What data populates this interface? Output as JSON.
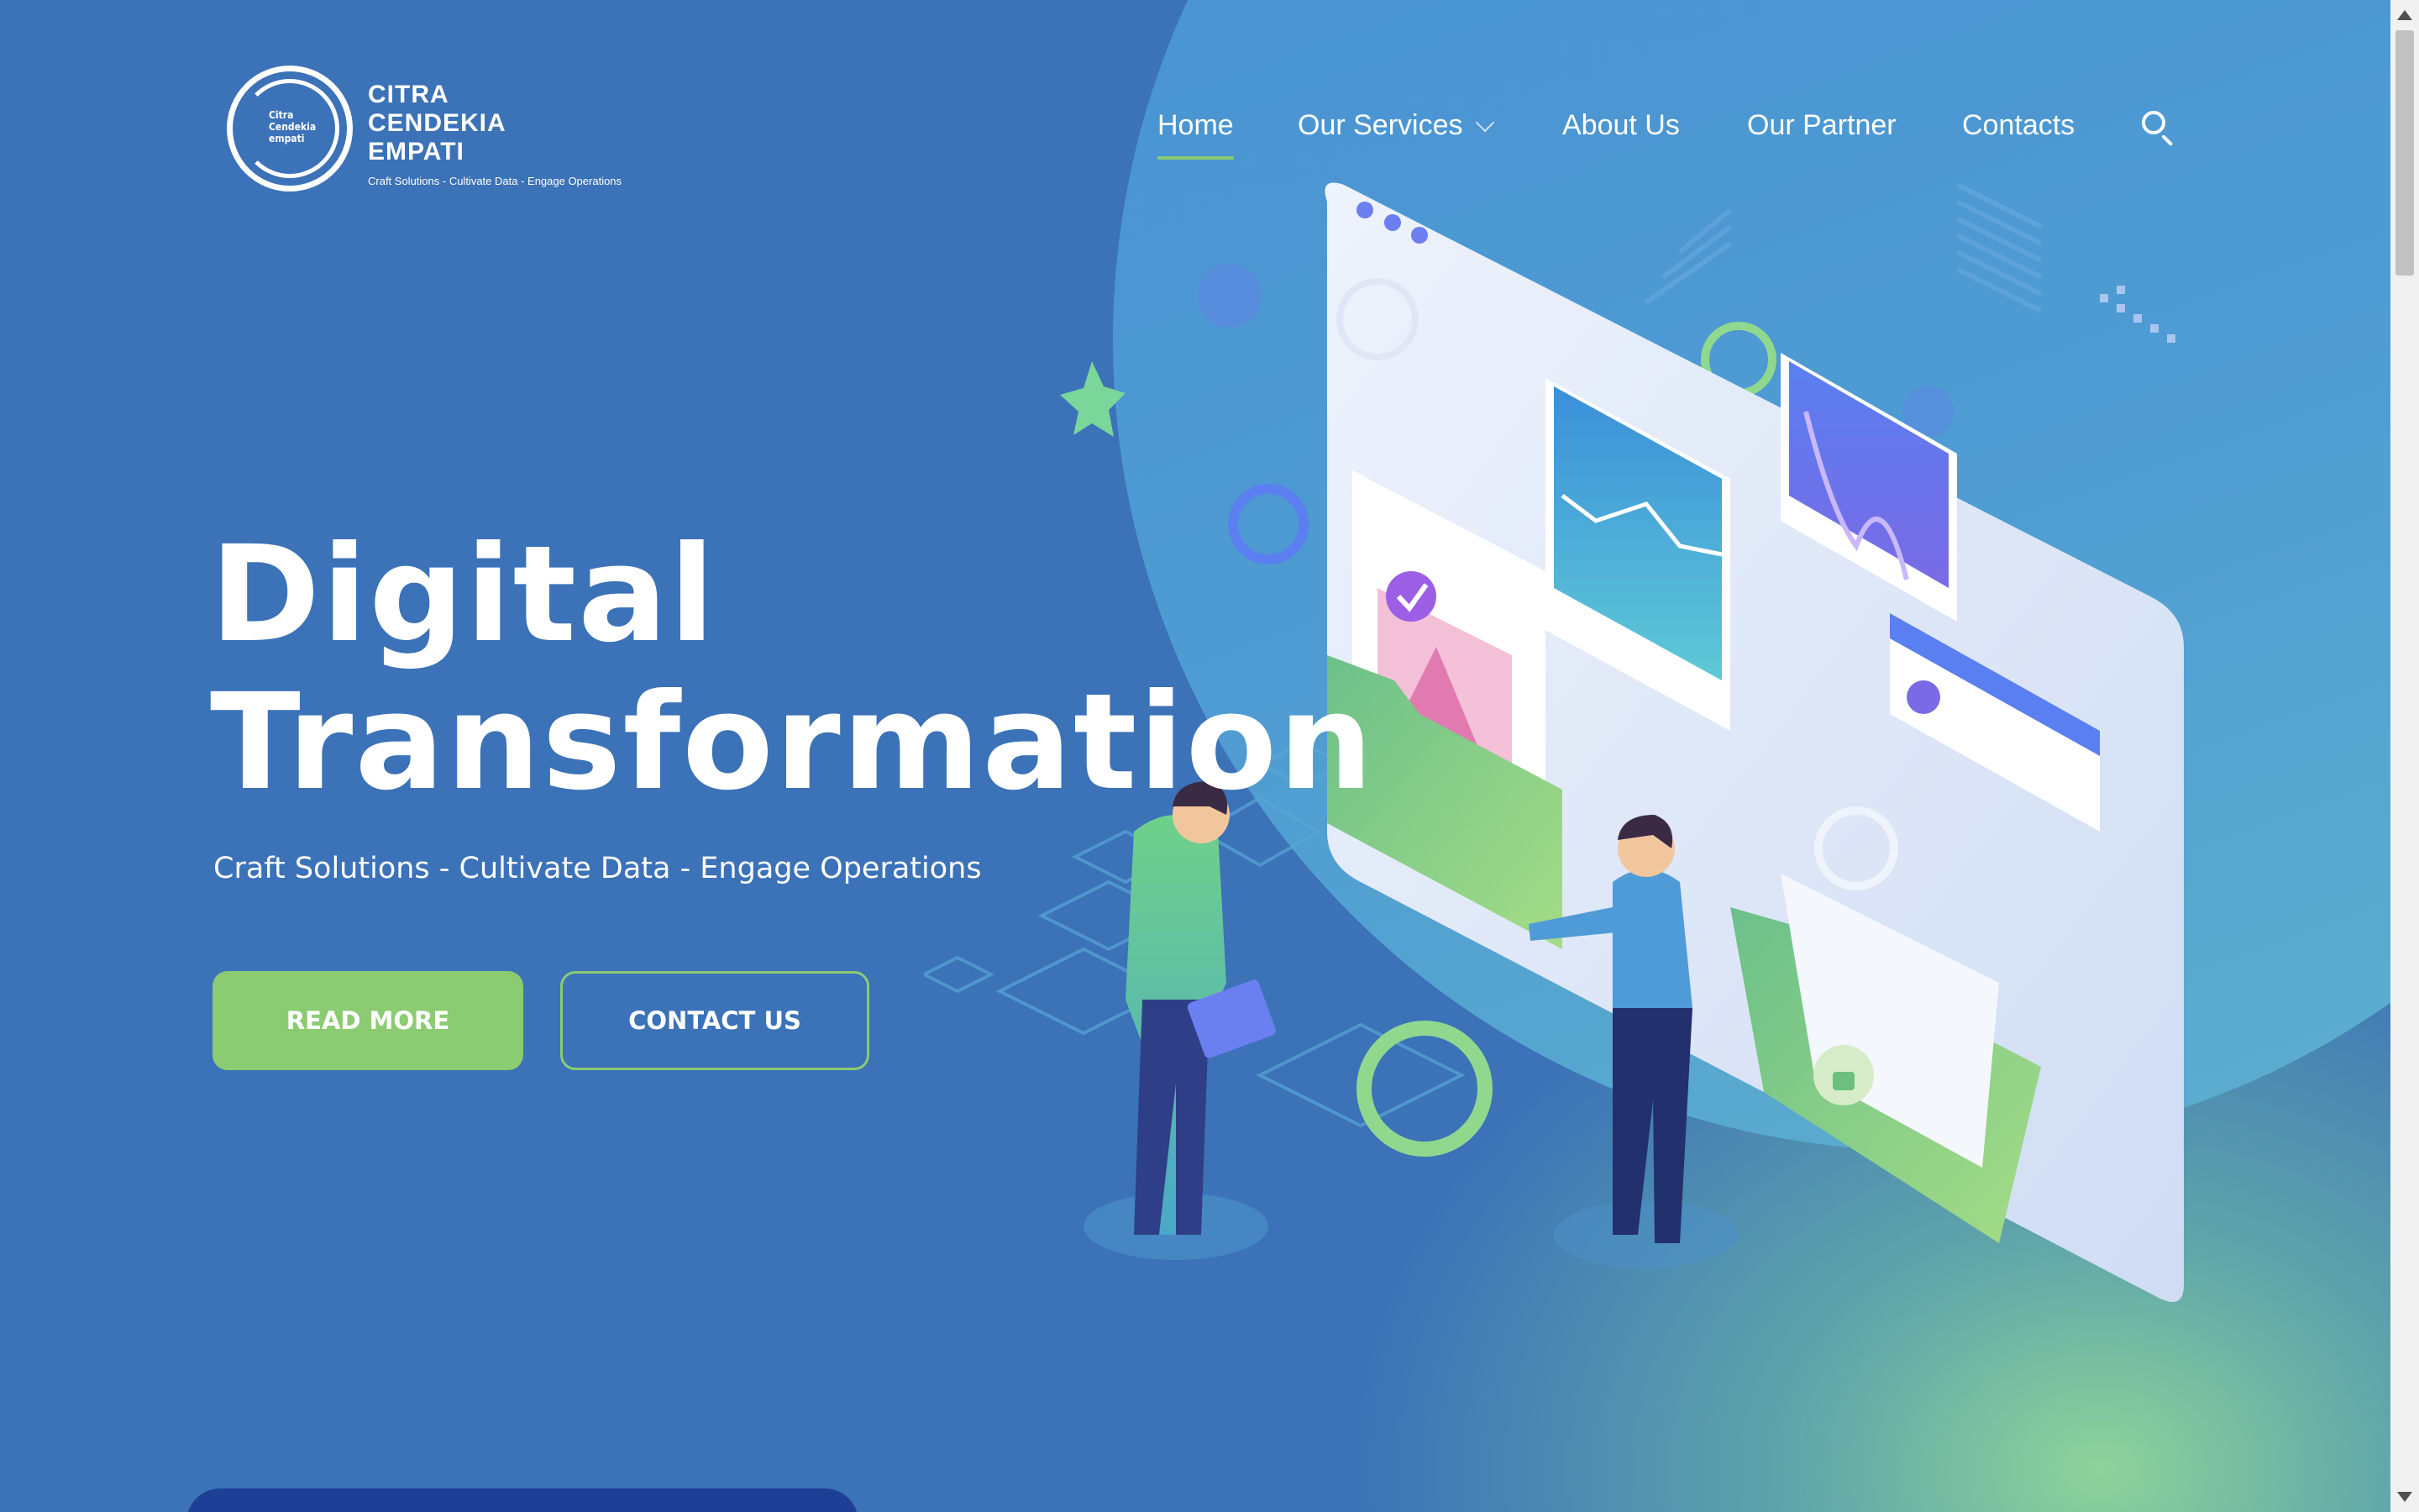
{
  "logo": {
    "mini_lines": [
      "Citra",
      "Cendekia",
      "empati"
    ],
    "name_lines": [
      "CITRA",
      "CENDEKIA",
      "EMPATI"
    ],
    "tagline": "Craft Solutions - Cultivate Data - Engage Operations"
  },
  "nav": {
    "home": "Home",
    "services": "Our Services",
    "about": "About Us",
    "partner": "Our Partner",
    "contacts": "Contacts",
    "search_icon": "search-icon",
    "active": "Home"
  },
  "hero": {
    "title_line1": "Digital",
    "title_line2": "Transformation",
    "subtitle": "Craft Solutions - Cultivate Data - Engage Operations",
    "read_more": "READ MORE",
    "contact_us": "CONTACT US"
  },
  "colors": {
    "background": "#3b72b8",
    "accent_green": "#8bcb72",
    "circle_blue": "#4690d2"
  }
}
